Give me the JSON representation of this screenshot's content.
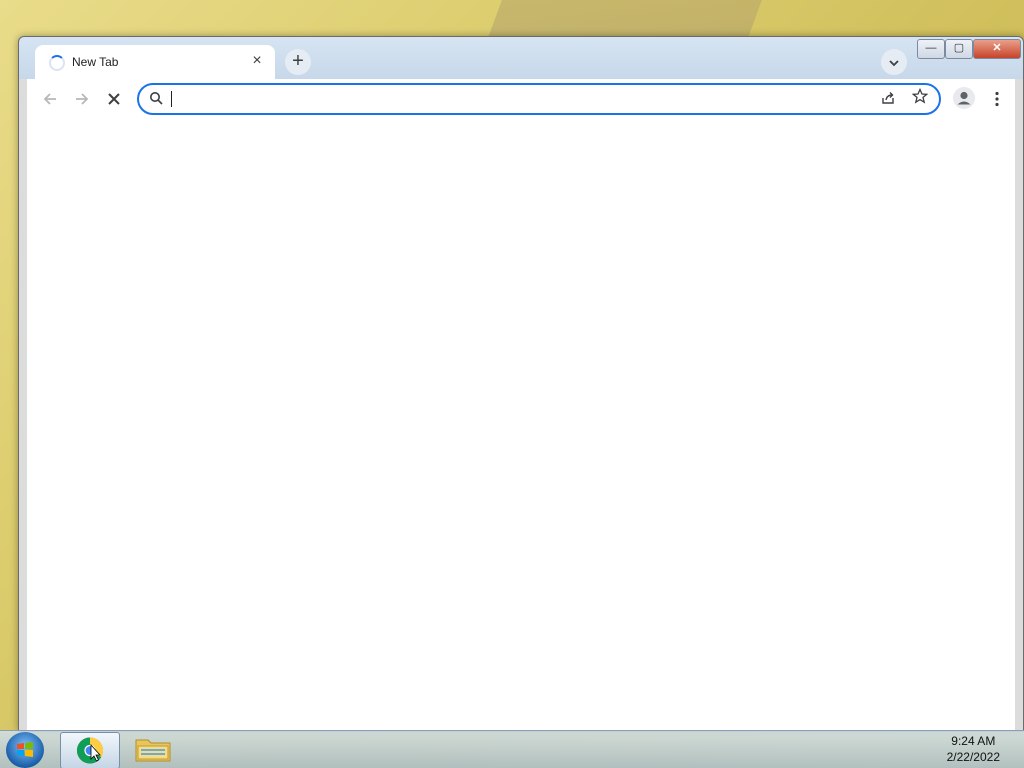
{
  "browser": {
    "tab": {
      "title": "New Tab",
      "loading": true
    },
    "new_tab_button": "+",
    "tab_search_icon": "chevron-down-icon",
    "window_controls": {
      "minimize": "—",
      "maximize": "▢",
      "close": "✕"
    }
  },
  "toolbar": {
    "back_icon": "arrow-left-icon",
    "forward_icon": "arrow-right-icon",
    "stop_icon": "close-icon",
    "omnibox": {
      "value": "",
      "placeholder": ""
    },
    "share_icon": "share-icon",
    "bookmark_icon": "star-icon",
    "profile_icon": "profile-icon",
    "menu_icon": "kebab-menu-icon"
  },
  "taskbar": {
    "clock": {
      "time": "9:24 AM",
      "date": "2/22/2022"
    },
    "apps": [
      "chrome",
      "file-explorer"
    ]
  },
  "colors": {
    "accent": "#1a73e8",
    "taskbar": "#b6c8d8"
  }
}
